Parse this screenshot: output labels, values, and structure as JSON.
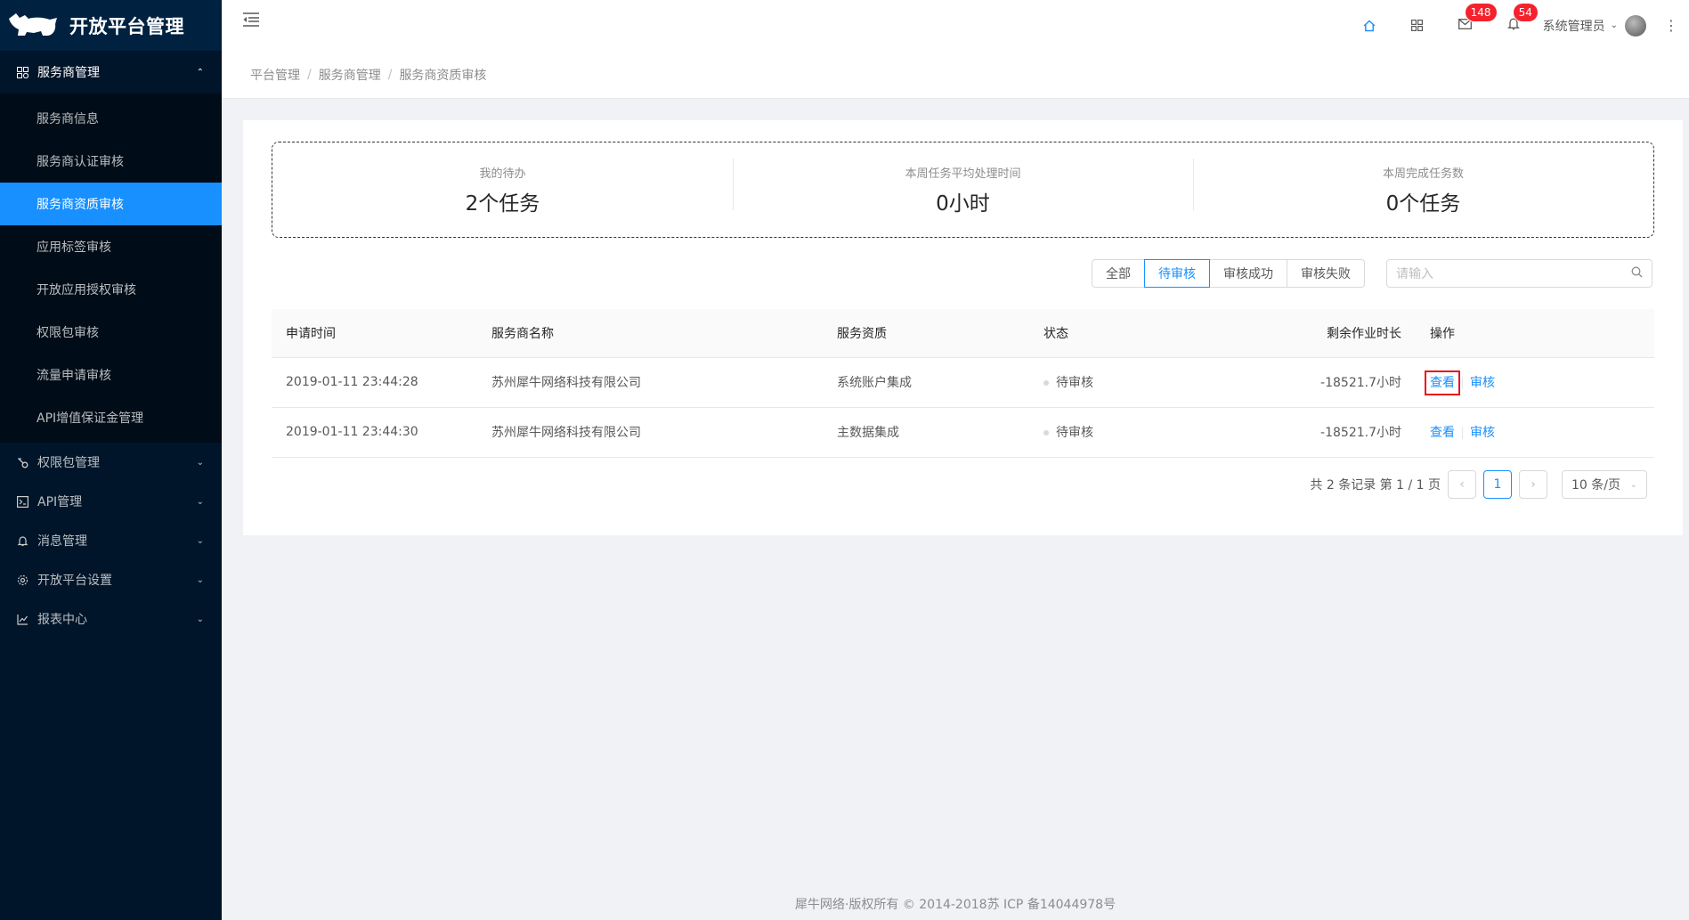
{
  "app": {
    "title": "开放平台管理"
  },
  "sidebar": {
    "group": {
      "label": "服务商管理",
      "expanded": true
    },
    "subitems": [
      {
        "label": "服务商信息",
        "active": false
      },
      {
        "label": "服务商认证审核",
        "active": false
      },
      {
        "label": "服务商资质审核",
        "active": true
      },
      {
        "label": "应用标签审核",
        "active": false
      },
      {
        "label": "开放应用授权审核",
        "active": false
      },
      {
        "label": "权限包审核",
        "active": false
      },
      {
        "label": "流量申请审核",
        "active": false
      },
      {
        "label": "API增值保证金管理",
        "active": false
      }
    ],
    "menus": [
      {
        "label": "权限包管理",
        "icon": "key-icon"
      },
      {
        "label": "API管理",
        "icon": "api-icon"
      },
      {
        "label": "消息管理",
        "icon": "bell-icon"
      },
      {
        "label": "开放平台设置",
        "icon": "gear-icon"
      },
      {
        "label": "报表中心",
        "icon": "line-chart-icon"
      }
    ]
  },
  "header": {
    "mail_count": "148",
    "notice_count": "54",
    "user_name": "系统管理员"
  },
  "breadcrumb": [
    "平台管理",
    "服务商管理",
    "服务商资质审核"
  ],
  "stats": [
    {
      "title": "我的待办",
      "value": "2个任务"
    },
    {
      "title": "本周任务平均处理时间",
      "value": "0小时"
    },
    {
      "title": "本周完成任务数",
      "value": "0个任务"
    }
  ],
  "filters": {
    "options": [
      "全部",
      "待审核",
      "审核成功",
      "审核失败"
    ],
    "selected": "待审核",
    "search_placeholder": "请输入"
  },
  "table": {
    "columns": [
      "申请时间",
      "服务商名称",
      "服务资质",
      "状态",
      "剩余作业时长",
      "操作"
    ],
    "rows": [
      {
        "time": "2019-01-11 23:44:28",
        "name": "苏州犀牛网络科技有限公司",
        "qual": "系统账户集成",
        "status": "待审核",
        "remain": "-18521.7小时",
        "view": "查看",
        "audit": "审核"
      },
      {
        "time": "2019-01-11 23:44:30",
        "name": "苏州犀牛网络科技有限公司",
        "qual": "主数据集成",
        "status": "待审核",
        "remain": "-18521.7小时",
        "view": "查看",
        "audit": "审核"
      }
    ]
  },
  "pagination": {
    "summary": "共 2 条记录 第 1 / 1 页",
    "current": "1",
    "page_size": "10 条/页"
  },
  "footer": {
    "text": "犀牛网络·版权所有 © 2014-2018苏 ICP 备14044978号"
  },
  "colors": {
    "primary": "#1890ff",
    "sidebar": "#001529",
    "highlight": "#e8141b"
  }
}
